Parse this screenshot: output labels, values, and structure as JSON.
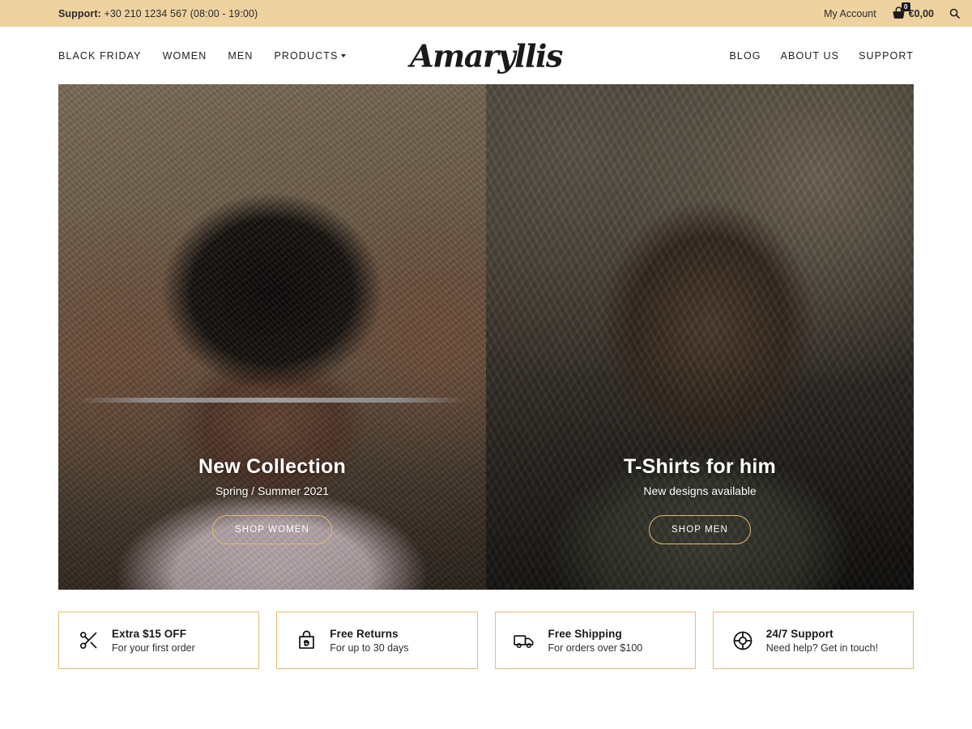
{
  "topbar": {
    "support_label": "Support:",
    "support_phone": " +30 210 1234 567 (08:00 - 19:00)",
    "account_label": "My Account",
    "cart_icon": "shopping-basket-icon",
    "cart_count": "0",
    "cart_total": "€0,00",
    "search_icon": "search-icon",
    "background": "#eed2a0"
  },
  "header": {
    "logo": "Amaryllis",
    "nav_left": [
      {
        "label": "BLACK FRIDAY",
        "has_dropdown": false
      },
      {
        "label": "WOMEN",
        "has_dropdown": false
      },
      {
        "label": "MEN",
        "has_dropdown": false
      },
      {
        "label": "PRODUCTS",
        "has_dropdown": true
      }
    ],
    "nav_right": [
      {
        "label": "BLOG"
      },
      {
        "label": "ABOUT US"
      },
      {
        "label": "SUPPORT"
      }
    ]
  },
  "hero": {
    "panels": [
      {
        "title": "New Collection",
        "subtitle": "Spring / Summer 2021",
        "button": "SHOP WOMEN",
        "image_alt": "woman in pink t-shirt outdoors"
      },
      {
        "title": "T-Shirts for him",
        "subtitle": "New designs available",
        "button": "SHOP MEN",
        "image_alt": "man in olive t-shirt shielding eyes"
      }
    ],
    "button_border_color": "#e3b771"
  },
  "features": {
    "border_color": "#e8bd74",
    "items": [
      {
        "icon": "scissors-icon",
        "title": "Extra $15 OFF",
        "subtitle": "For your first order"
      },
      {
        "icon": "return-bag-icon",
        "title": "Free Returns",
        "subtitle": "For up to 30 days"
      },
      {
        "icon": "truck-icon",
        "title": "Free Shipping",
        "subtitle": "For orders over $100"
      },
      {
        "icon": "lifebuoy-icon",
        "title": "24/7 Support",
        "subtitle": "Need help? Get in touch!"
      }
    ]
  }
}
